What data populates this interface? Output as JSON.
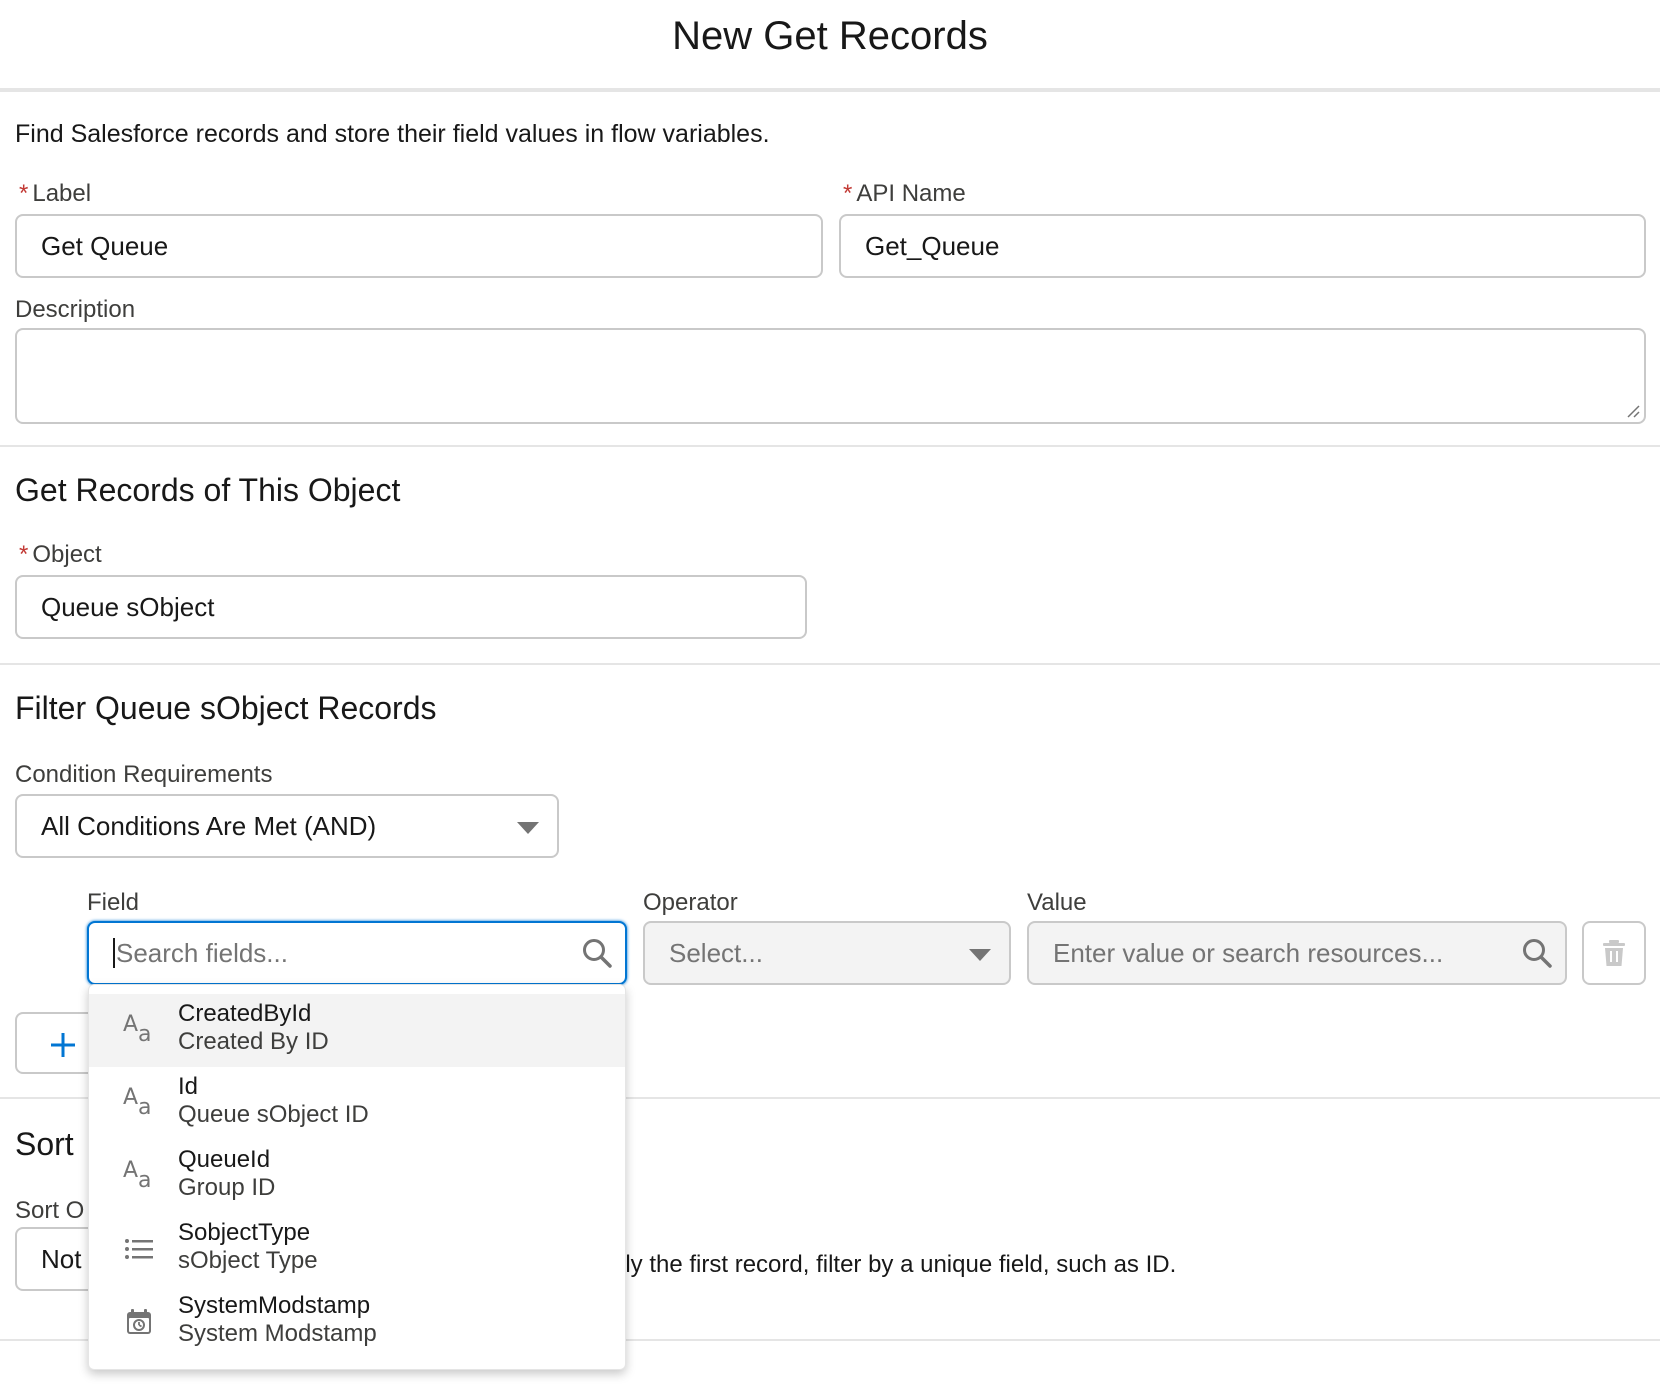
{
  "header": {
    "title": "New Get Records"
  },
  "intro": "Find Salesforce records and store their field values in flow variables.",
  "required_marker": "*",
  "label_field": {
    "label": "Label",
    "value": "Get Queue"
  },
  "api_name_field": {
    "label": "API Name",
    "value": "Get_Queue"
  },
  "description_field": {
    "label": "Description",
    "value": ""
  },
  "object_section": {
    "title": "Get Records of This Object",
    "object_label": "Object",
    "object_value": "Queue sObject"
  },
  "filter_section": {
    "title": "Filter Queue sObject Records",
    "condition_label": "Condition Requirements",
    "condition_value": "All Conditions Are Met (AND)",
    "field_label": "Field",
    "field_placeholder": "Search fields...",
    "operator_label": "Operator",
    "operator_placeholder": "Select...",
    "value_label": "Value",
    "value_placeholder": "Enter value or search resources..."
  },
  "sort_section": {
    "title_partial": "Sort",
    "order_label_partial": "Sort O",
    "order_value_partial": "Not",
    "note_partial": "nly the first record, filter by a unique field, such as ID."
  },
  "dropdown": {
    "options": [
      {
        "name": "CreatedById",
        "label": "Created By ID",
        "icon": "text-icon"
      },
      {
        "name": "Id",
        "label": "Queue sObject ID",
        "icon": "text-icon"
      },
      {
        "name": "QueueId",
        "label": "Group ID",
        "icon": "text-icon"
      },
      {
        "name": "SobjectType",
        "label": "sObject Type",
        "icon": "picklist-icon"
      },
      {
        "name": "SystemModstamp",
        "label": "System Modstamp",
        "icon": "datetime-icon"
      }
    ]
  },
  "colors": {
    "focus": "#0176d3",
    "required": "#c23934",
    "border": "#c9c9c9",
    "add_icon": "#0176d3"
  }
}
